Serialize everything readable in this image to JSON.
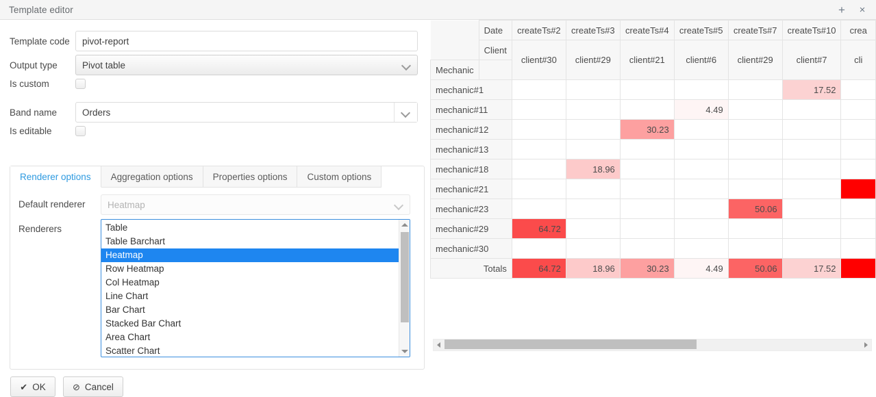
{
  "window": {
    "title": "Template editor",
    "expand_icon": "+",
    "close_icon": "×"
  },
  "form": {
    "template_code": {
      "label": "Template code",
      "value": "pivot-report"
    },
    "output_type": {
      "label": "Output type",
      "value": "Pivot table"
    },
    "is_custom": {
      "label": "Is custom",
      "checked": false
    },
    "band_name": {
      "label": "Band name",
      "value": "Orders"
    },
    "is_editable": {
      "label": "Is editable",
      "checked": false
    }
  },
  "tabs": [
    {
      "label": "Renderer options",
      "active": true
    },
    {
      "label": "Aggregation options",
      "active": false
    },
    {
      "label": "Properties options",
      "active": false
    },
    {
      "label": "Custom options",
      "active": false
    }
  ],
  "renderer_options": {
    "default_renderer": {
      "label": "Default renderer",
      "value": "Heatmap",
      "disabled": true
    },
    "renderers": {
      "label": "Renderers",
      "selected": "Heatmap",
      "items": [
        "Table",
        "Table Barchart",
        "Heatmap",
        "Row Heatmap",
        "Col Heatmap",
        "Line Chart",
        "Bar Chart",
        "Stacked Bar Chart",
        "Area Chart",
        "Scatter Chart"
      ]
    }
  },
  "buttons": {
    "ok": {
      "label": "OK",
      "icon": "✔"
    },
    "cancel": {
      "label": "Cancel",
      "icon": "⊘"
    }
  },
  "pivot": {
    "row_axis_label": "Mechanic",
    "col_axis_labels": [
      "Date",
      "Client"
    ],
    "totals_label": "Totals",
    "date_headers": [
      "createTs#2",
      "createTs#3",
      "createTs#4",
      "createTs#5",
      "createTs#7",
      "createTs#10",
      "crea"
    ],
    "client_headers": [
      "client#30",
      "client#29",
      "client#21",
      "client#6",
      "client#29",
      "client#7",
      "cli"
    ],
    "rows": [
      {
        "label": "mechanic#1",
        "cells": [
          "",
          "",
          "",
          "",
          "",
          "17.52",
          ""
        ]
      },
      {
        "label": "mechanic#11",
        "cells": [
          "",
          "",
          "",
          "4.49",
          "",
          "",
          ""
        ]
      },
      {
        "label": "mechanic#12",
        "cells": [
          "",
          "",
          "30.23",
          "",
          "",
          "",
          ""
        ]
      },
      {
        "label": "mechanic#13",
        "cells": [
          "",
          "",
          "",
          "",
          "",
          "",
          ""
        ]
      },
      {
        "label": "mechanic#18",
        "cells": [
          "",
          "18.96",
          "",
          "",
          "",
          "",
          ""
        ]
      },
      {
        "label": "mechanic#21",
        "cells": [
          "",
          "",
          "",
          "",
          "",
          "",
          ""
        ]
      },
      {
        "label": "mechanic#23",
        "cells": [
          "",
          "",
          "",
          "",
          "50.06",
          "",
          ""
        ]
      },
      {
        "label": "mechanic#29",
        "cells": [
          "64.72",
          "",
          "",
          "",
          "",
          "",
          ""
        ]
      },
      {
        "label": "mechanic#30",
        "cells": [
          "",
          "",
          "",
          "",
          "",
          "",
          ""
        ]
      }
    ],
    "totals_row": [
      "64.72",
      "18.96",
      "30.23",
      "4.49",
      "50.06",
      "17.52",
      ""
    ],
    "heat_colors": {
      "64.72": "#fb4b4b",
      "50.06": "#fc6464",
      "30.23": "#fda0a0",
      "18.96": "#fdcaca",
      "17.52": "#fcd2d2",
      "4.49": "#fef5f5",
      "max": "#ff0000"
    }
  },
  "colors": {
    "accent": "#2e9ae0",
    "select_highlight": "#1e86f0",
    "heat_min": "#fff5f5",
    "heat_max": "#ff0000"
  }
}
